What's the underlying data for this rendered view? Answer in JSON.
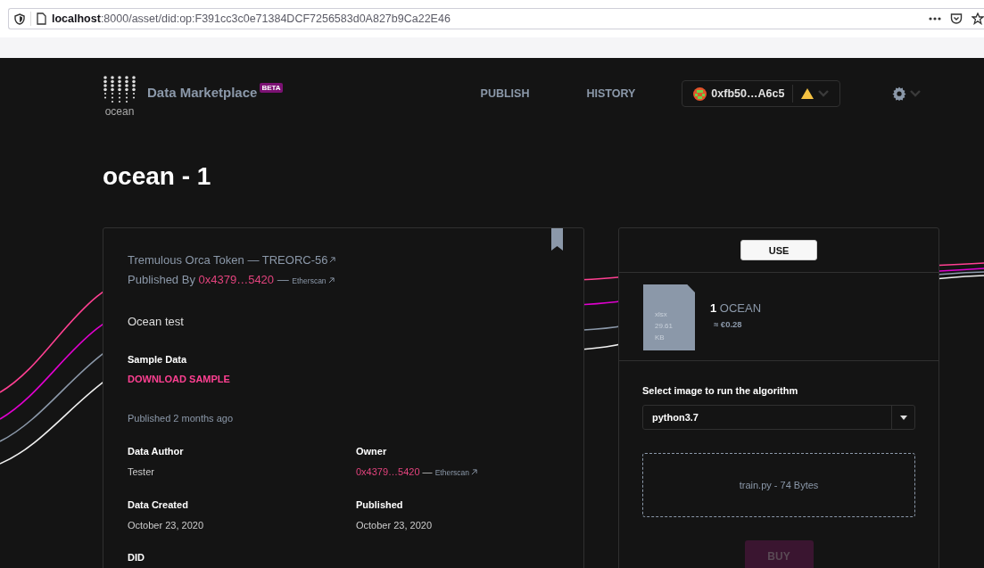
{
  "browser": {
    "url_host": "localhost",
    "url_path": ":8000/asset/did:op:F391cc3c0e71384DCF7256583d0A827b9Ca22E46"
  },
  "header": {
    "logo_text": "ocean",
    "brand": "Data Marketplace",
    "badge": "BETA",
    "nav": [
      "PUBLISH",
      "HISTORY"
    ],
    "wallet": {
      "address": "0xfb50…A6c5",
      "warning": true
    }
  },
  "title": "ocean - 1",
  "asset": {
    "token": "Tremulous Orca Token — TREORC-56",
    "published_by": "Published By",
    "publisher": "0x4379…5420",
    "separator": "—",
    "etherscan": "Etherscan",
    "description": "Ocean test",
    "sample_label": "Sample Data",
    "sample_link": "DOWNLOAD SAMPLE",
    "published_ago": "Published 2 months ago",
    "meta": [
      {
        "label": "Data Author",
        "kind": "text",
        "value": "Tester"
      },
      {
        "label": "Owner",
        "kind": "address",
        "value": "0x4379…5420",
        "separator": "—",
        "link": "Etherscan"
      },
      {
        "label": "Data Created",
        "kind": "text",
        "value": "October 23, 2020"
      },
      {
        "label": "Published",
        "kind": "text",
        "value": "October 23, 2020"
      },
      {
        "label": "DID",
        "kind": "text"
      }
    ]
  },
  "consume": {
    "use_button": "USE",
    "file": {
      "type": "xlsx",
      "size": "29.61",
      "unit": "KB"
    },
    "price": {
      "amount": "1",
      "token": "OCEAN",
      "fiat": "≈ €0.28"
    },
    "select_label": "Select image to run the algorithm",
    "select_value": "python3.7",
    "algorithm": "train.py - 74 Bytes",
    "buy": {
      "label": "BUY",
      "disabled": true
    }
  }
}
